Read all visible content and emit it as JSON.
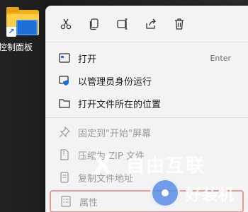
{
  "desktop": {
    "icon_label": "控制面板",
    "shortcut_glyph": "↗"
  },
  "toolbar": {
    "buttons": [
      {
        "icon": "scissors-icon",
        "label": "剪切"
      },
      {
        "icon": "copy-icon",
        "label": "复制"
      },
      {
        "icon": "rename-icon",
        "label": "重命名"
      },
      {
        "icon": "share-icon",
        "label": "共享"
      },
      {
        "icon": "trash-icon",
        "label": "删除"
      }
    ]
  },
  "menu": {
    "items": [
      {
        "label": "打开",
        "shortcut": "Enter"
      },
      {
        "label": "以管理员身份运行"
      },
      {
        "label": "打开文件所在的位置"
      },
      {
        "label": "固定到\"开始\"屏幕"
      },
      {
        "label": "压缩为 ZIP 文件"
      },
      {
        "label": "复制文件地址"
      },
      {
        "label": "属性"
      }
    ]
  },
  "watermark": {
    "x": "X",
    "line1": "自由互联",
    "line2": "好装机"
  },
  "colors": {
    "menu_bg": "#f3f3f3",
    "accent": "#1d6fd6",
    "highlight_border": "#e39a9a"
  }
}
